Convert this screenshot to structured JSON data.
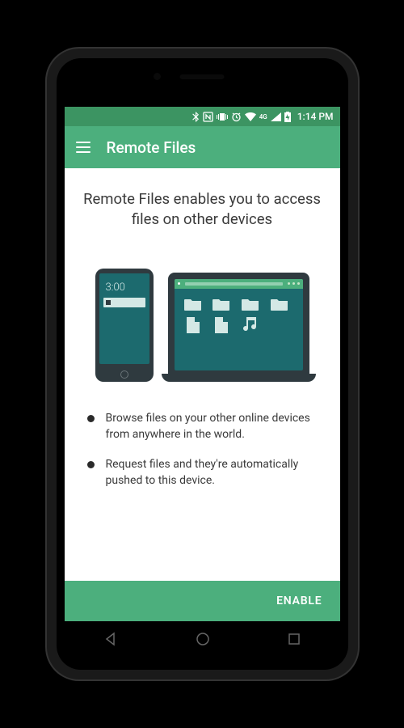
{
  "status": {
    "time": "1:14 PM",
    "network_label": "4G",
    "icons": [
      "bluetooth",
      "nfc",
      "vibrate",
      "alarm",
      "wifi",
      "cellular",
      "signal",
      "battery-charging"
    ]
  },
  "appbar": {
    "title": "Remote Files",
    "menu_icon": "hamburger"
  },
  "content": {
    "headline": "Remote Files enables you to access files on other devices",
    "illustration": {
      "phone_clock": "3:00",
      "laptop_files": [
        "folder",
        "folder",
        "folder",
        "folder",
        "document",
        "document",
        "music"
      ]
    },
    "bullets": [
      "Browse files on your other online devices from anywhere in the world.",
      "Request files and they're automatically pushed to this device."
    ]
  },
  "bottombar": {
    "enable_label": "ENABLE"
  },
  "navbar": {
    "buttons": [
      "back",
      "home",
      "recent"
    ]
  },
  "colors": {
    "primary": "#4caf7d",
    "primary_dark": "#3c9462",
    "illustration_dark": "#2f3a3f",
    "illustration_teal": "#1c6a6e"
  }
}
